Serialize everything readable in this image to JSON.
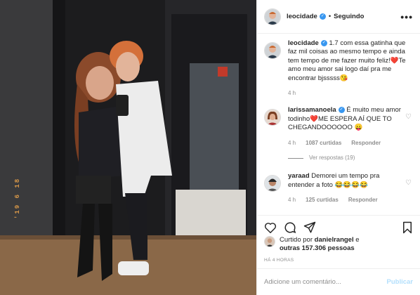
{
  "post": {
    "author": "leocidade",
    "follow_state": "Seguindo",
    "more_glyph": "•••",
    "photo_stamp": "'19 6 18"
  },
  "caption": {
    "user": "leocidade",
    "text": "1.7 com essa gatinha que faz mil coisas ao mesmo tempo e ainda tem tempo de me fazer muito feliz!❤️Te amo meu amor sai logo daí pra me encontrar bjsssss😘",
    "time": "4 h"
  },
  "comments": [
    {
      "user": "larissamanoela",
      "text": "É muito meu amor todinho❤️ME ESPERA AÍ QUE TO CHEGANDOOOOOO 😛",
      "time": "4 h",
      "likes": "1087 curtidas",
      "reply_label": "Responder",
      "view_replies": "Ver respostas (19)"
    },
    {
      "user": "yaraad",
      "text": "Demorei um tempo pra entender a foto 😂😂😂😂",
      "time": "4 h",
      "likes": "125 curtidas",
      "reply_label": "Responder"
    }
  ],
  "likes": {
    "prefix": "Curtido por",
    "user": "danielrangel",
    "conj": "e",
    "others": "outras 157.306 pessoas"
  },
  "timestamp": "HÁ 4 HORAS",
  "add_comment": {
    "placeholder": "Adicione um comentário...",
    "publish_label": "Publicar"
  },
  "colors": {
    "verified": "#3897f0",
    "publish_disabled": "#b2dffc",
    "muted": "#8e8e8e",
    "stamp": "#e8a24a"
  }
}
